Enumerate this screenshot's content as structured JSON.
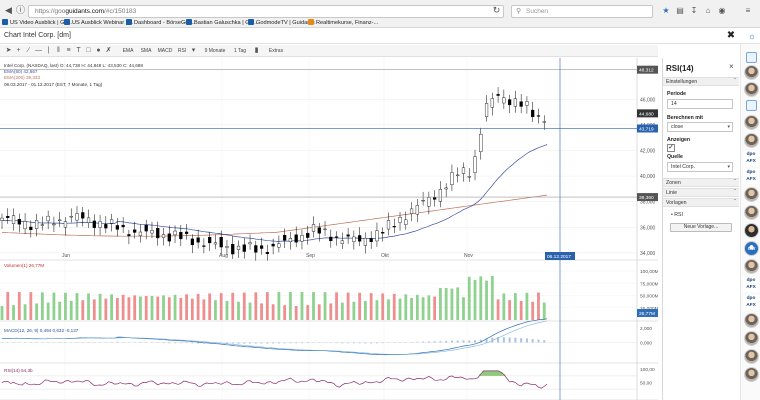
{
  "browser": {
    "url_prefix": "https://goo",
    "url_host": "guidants.com",
    "url_rest": "/#c/150183",
    "search_placeholder": "Suchen",
    "bookmarks": [
      "US Video Ausblick | Gu...",
      "US Ausblick Webinar | ...",
      "Dashboard - BörseGo ...",
      "Bastian Galuschka | Gu...",
      "GodmodeTV | Guidants",
      "Realtimekurse, Finanz-..."
    ]
  },
  "window": {
    "title": "Chart Intel Corp. [dm]"
  },
  "toolbar": {
    "items": [
      "EMA",
      "SMA",
      "MACD",
      "RSI",
      "9 Monate",
      "1 Tag",
      "Extras"
    ]
  },
  "chart": {
    "header": {
      "line1": "Intel Corp. (NASDAQ, last)  O: 44,738  H: 44,848  L: 43,530  C: 44,688",
      "ema50": "EMA(50)  42,667",
      "ema200": "EMA(200)  39,333",
      "range": "08.03.2017 - 01.12.2017  (EST, 7 Monate, 1 Tag)"
    },
    "price_axis": [
      "46,000",
      "44,000",
      "42,000",
      "40,000",
      "38,000",
      "36,000",
      "34,000"
    ],
    "price_badges": {
      "top": "48,312",
      "close": "44,680",
      "cursor": "43,719",
      "level": "38,360"
    },
    "months": [
      "Jun",
      "Aug",
      "Sep",
      "Okt",
      "Nov"
    ],
    "date_badge": "06.12.2017",
    "volume": {
      "label": "Volumen(1)  26,77M",
      "axis": [
        "100,00M",
        "75,000M",
        "50,000M",
        "25,000M"
      ],
      "badge": "26,77M"
    },
    "macd": {
      "label": "MACD(12, 26, 9)  0,494  0,632  -0,137",
      "axis": [
        "2,000",
        "0,000"
      ]
    },
    "rsi": {
      "label": "RSI(14)  54,3b",
      "axis": [
        "100,00",
        "50,00"
      ]
    },
    "colors": {
      "up": "#ffffff",
      "down": "#000000",
      "ema50": "#3b4fa0",
      "ema200": "#c0715b",
      "vol_up": "#8fd18f",
      "vol_down": "#ee8f8f",
      "badge": "#2b62ae",
      "badge_dark": "#555555"
    }
  },
  "panel": {
    "title": "RSI(14)",
    "section_settings": "Einstellungen",
    "period_label": "Periode",
    "period_value": "14",
    "calc_label": "Berechnen mit",
    "calc_value": "close",
    "show_label": "Anzeigen",
    "source_label": "Quelle",
    "source_value": "Intel Corp.",
    "section_zones": "Zonen",
    "section_line": "Linie",
    "section_templates": "Vorlagen",
    "template_item": "RSI",
    "new_template": "Neue Vorlage..."
  },
  "sidebar_logos": [
    "dpo AFX",
    "dpo AFX",
    "dpo AFX",
    "dpo AFX"
  ],
  "sidebar_badge": "GW"
}
